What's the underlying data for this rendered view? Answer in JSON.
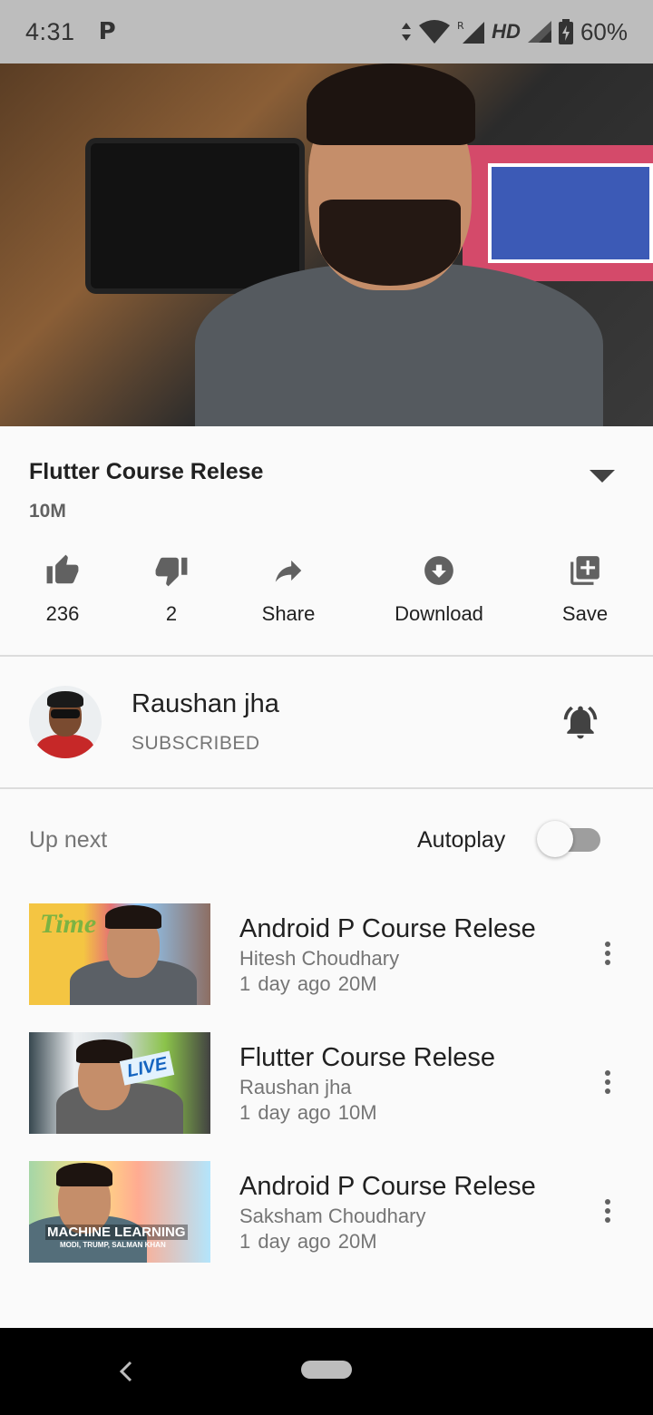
{
  "status_bar": {
    "time": "4:31",
    "notification_icon": "P",
    "network": "HD",
    "battery": "60%"
  },
  "video": {
    "title": "Flutter Course Relese",
    "views": "10M",
    "actions": [
      {
        "icon": "thumb-up-icon",
        "label": "236"
      },
      {
        "icon": "thumb-down-icon",
        "label": "2"
      },
      {
        "icon": "share-icon",
        "label": "Share"
      },
      {
        "icon": "download-icon",
        "label": "Download"
      },
      {
        "icon": "playlist-add-icon",
        "label": "Save"
      }
    ]
  },
  "channel": {
    "name": "Raushan jha",
    "status": "SUBSCRIBED"
  },
  "up_next": {
    "label": "Up next",
    "autoplay_label": "Autoplay",
    "autoplay_on": false
  },
  "thumbnail_text": {
    "t0": "Time",
    "t1": "LIVE",
    "t2": "MACHINE LEARNING",
    "t2_sub": "MODI, TRUMP, SALMAN KHAN"
  },
  "videos": [
    {
      "title": "Android P Course Relese",
      "channel": "Hitesh Choudhary",
      "meta": "1 day ago  20M"
    },
    {
      "title": "Flutter Course Relese",
      "channel": "Raushan jha",
      "meta": "1 day ago  10M"
    },
    {
      "title": "Android P Course Relese",
      "channel": "Saksham Choudhary",
      "meta": "1 day ago  20M"
    }
  ],
  "colors": {
    "status_bar": "#bdbdbd",
    "background": "#fafafa",
    "icon_gray": "#616161",
    "nav_bar": "#000000"
  }
}
